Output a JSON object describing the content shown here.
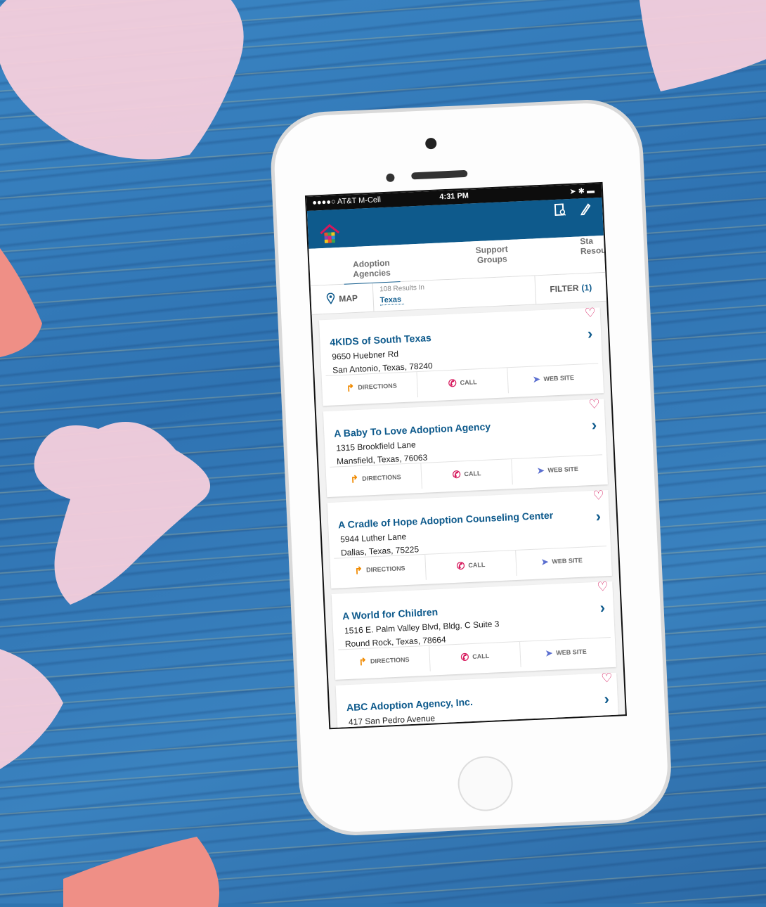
{
  "status_bar": {
    "carrier": "●●●●○ AT&T M-Cell",
    "time": "4:31 PM",
    "right": "➤ ✱ ▬"
  },
  "app_bar": {
    "icons": [
      "house-logo-icon",
      "saved-search-icon",
      "edit-pencil-icon"
    ]
  },
  "tabs": [
    {
      "label_line1": "Adoption",
      "label_line2": "Agencies",
      "active": true
    },
    {
      "label_line1": "Support",
      "label_line2": "Groups",
      "active": false
    },
    {
      "label_line1": "Sta",
      "label_line2": "Resou",
      "active": false
    }
  ],
  "toolbar": {
    "map_label": "MAP",
    "results_text": "108 Results In",
    "location": "Texas",
    "filter_label": "FILTER",
    "filter_count": "(1)"
  },
  "actions": {
    "directions": "DIRECTIONS",
    "call": "CALL",
    "website": "WEB SITE"
  },
  "listings": [
    {
      "name": "4KIDS of South Texas",
      "address1": "9650 Huebner Rd",
      "address2": "San Antonio, Texas, 78240"
    },
    {
      "name": "A Baby To Love Adoption Agency",
      "address1": "1315 Brookfield Lane",
      "address2": "Mansfield, Texas, 76063"
    },
    {
      "name": "A Cradle of Hope Adoption Counseling Center",
      "address1": "5944 Luther Lane",
      "address2": "Dallas, Texas, 75225"
    },
    {
      "name": "A World for Children",
      "address1": "1516 E. Palm Valley Blvd, Bldg. C Suite 3",
      "address2": "Round Rock, Texas, 78664"
    },
    {
      "name": "ABC Adoption Agency, Inc.",
      "address1": "417 San Pedro Avenue",
      "address2": ""
    }
  ],
  "colors": {
    "brand_blue": "#0e5a8c",
    "heart_pink": "#d6185c",
    "directions_orange": "#f08a00",
    "website_purple": "#5b6fd0"
  }
}
